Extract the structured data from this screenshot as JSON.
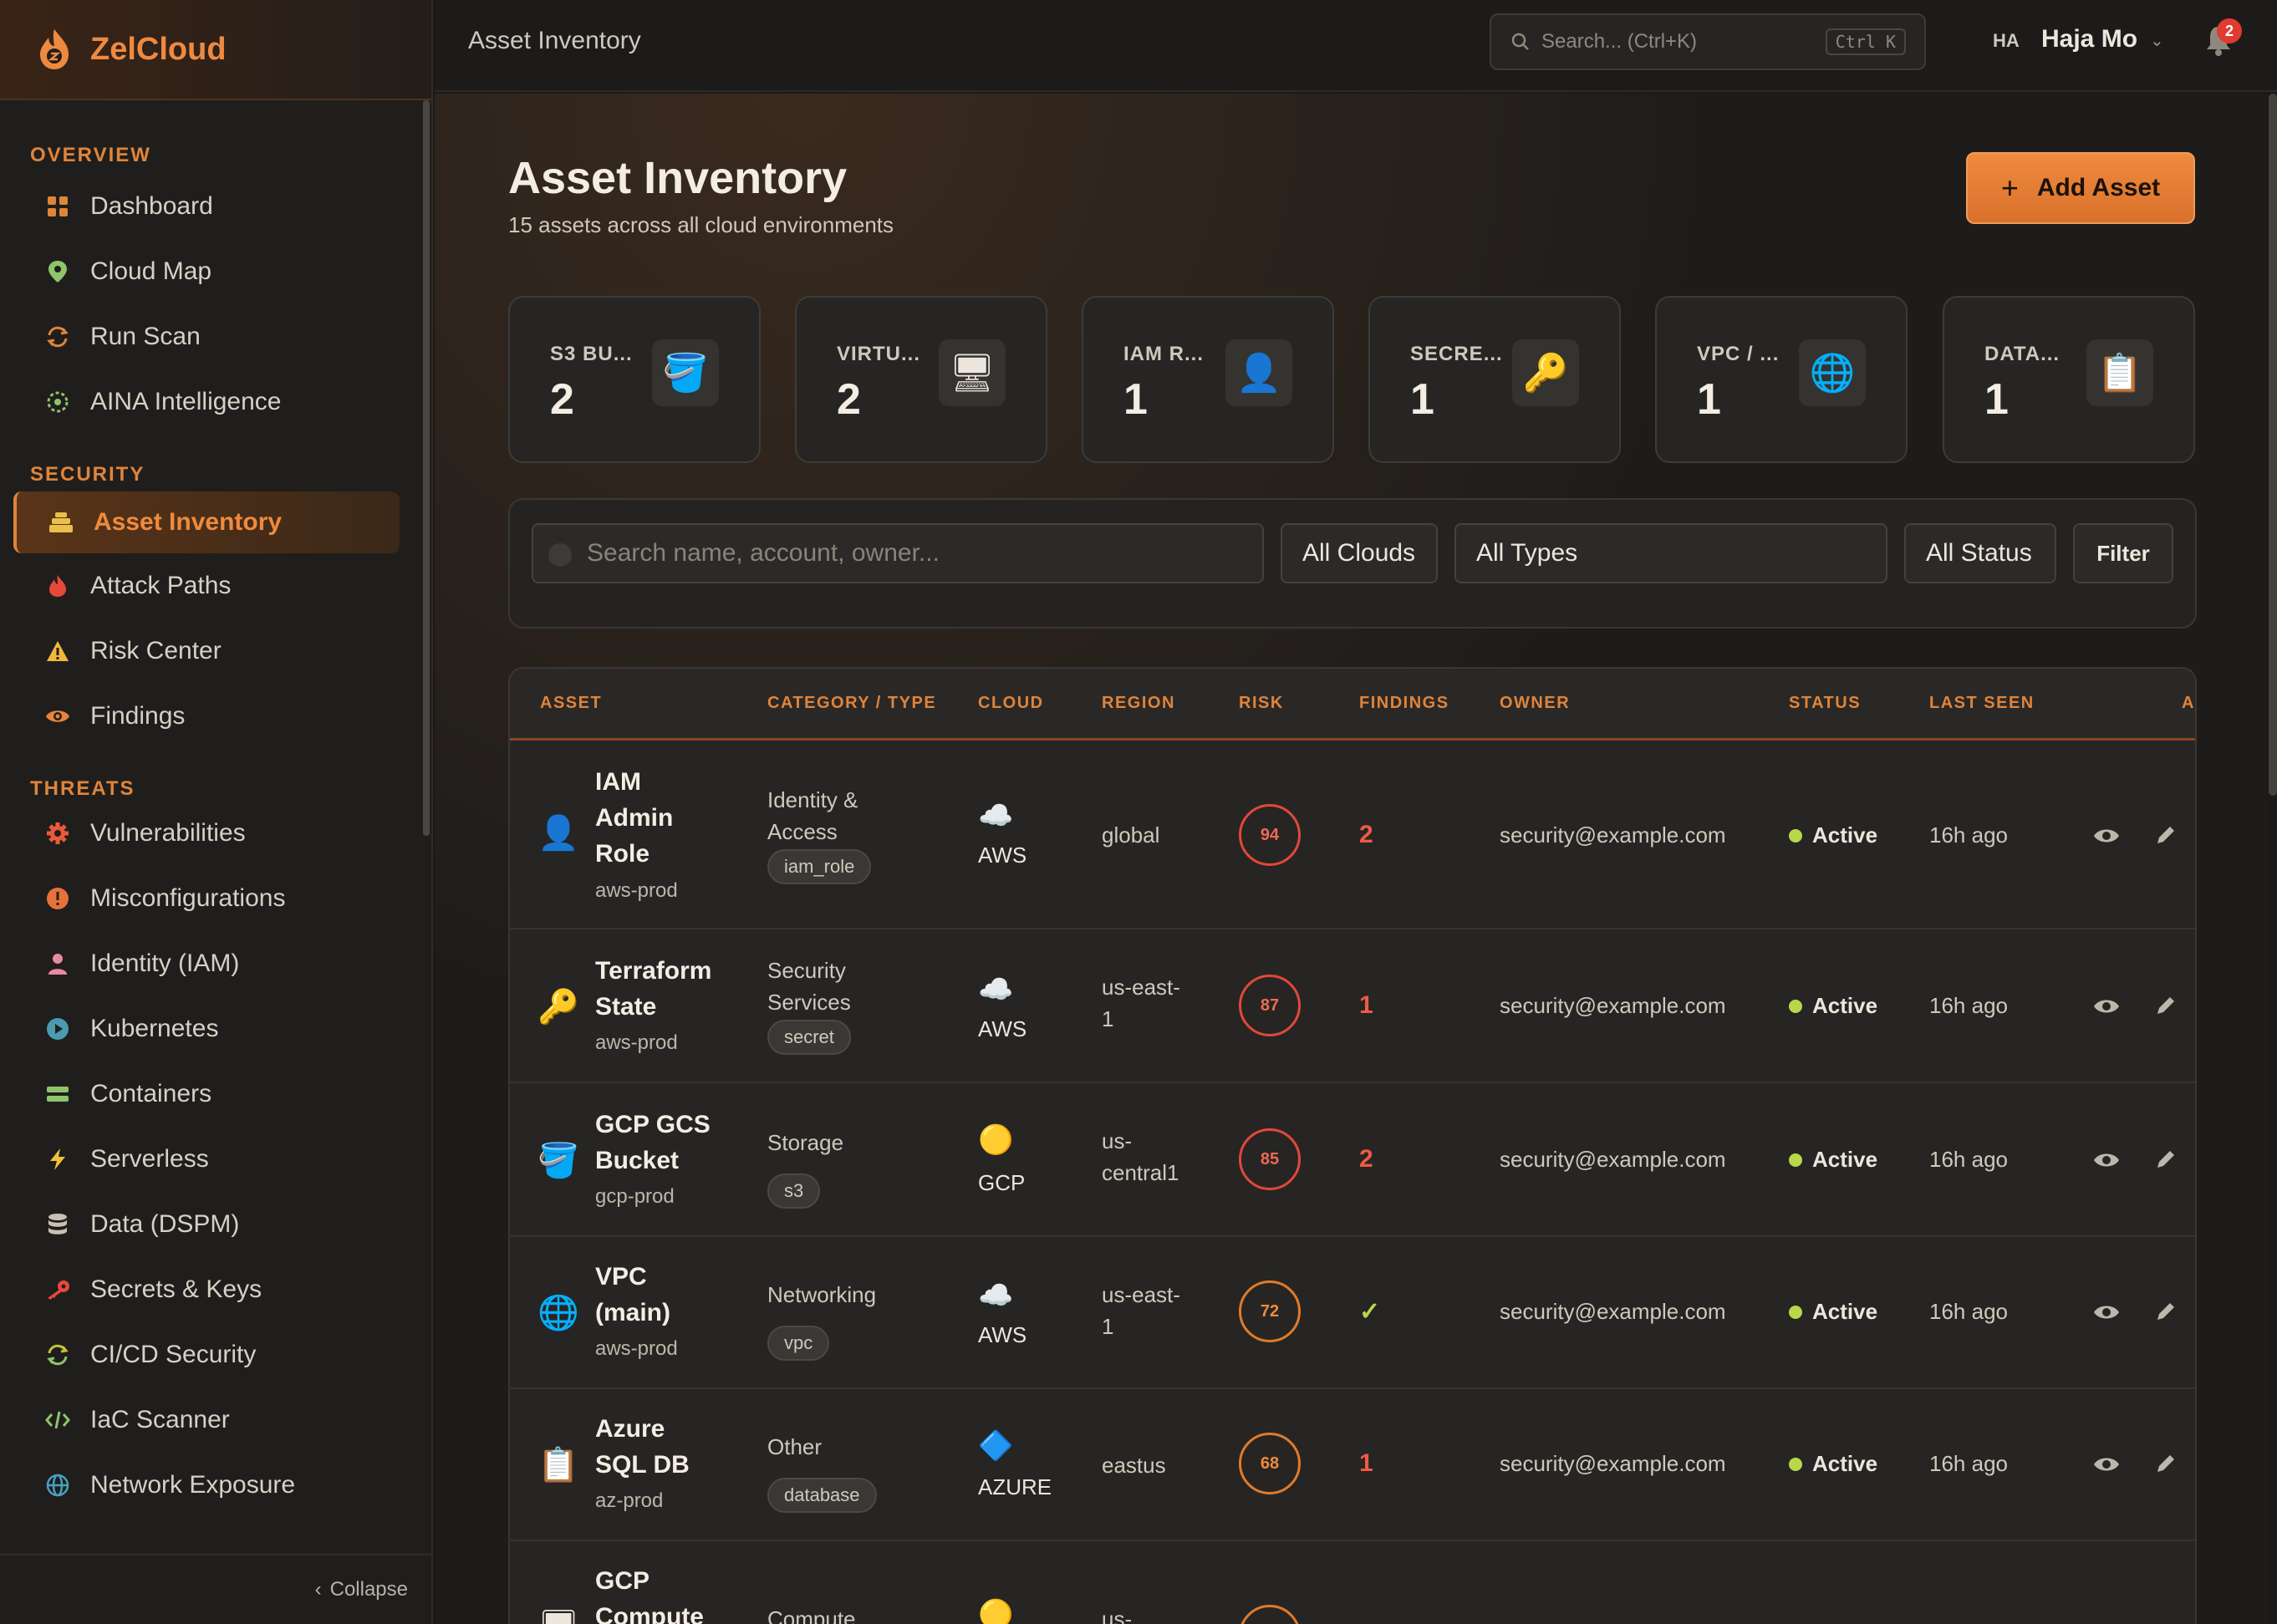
{
  "app": {
    "name": "ZelCloud"
  },
  "sidebar": {
    "sections": [
      {
        "label": "OVERVIEW",
        "items": [
          {
            "label": "Dashboard",
            "icon": "grid-icon"
          },
          {
            "label": "Cloud Map",
            "icon": "map-pin-icon"
          },
          {
            "label": "Run Scan",
            "icon": "refresh-icon"
          },
          {
            "label": "AINA Intelligence",
            "icon": "ai-icon"
          }
        ]
      },
      {
        "label": "SECURITY",
        "items": [
          {
            "label": "Asset Inventory",
            "icon": "layers-icon",
            "active": true
          },
          {
            "label": "Attack Paths",
            "icon": "flame-icon"
          },
          {
            "label": "Risk Center",
            "icon": "warning-icon"
          },
          {
            "label": "Findings",
            "icon": "eye-icon"
          }
        ]
      },
      {
        "label": "THREATS",
        "items": [
          {
            "label": "Vulnerabilities",
            "icon": "gear-icon"
          },
          {
            "label": "Misconfigurations",
            "icon": "alert-circle-icon"
          },
          {
            "label": "Identity (IAM)",
            "icon": "user-icon"
          },
          {
            "label": "Kubernetes",
            "icon": "play-circle-icon"
          },
          {
            "label": "Containers",
            "icon": "container-icon"
          },
          {
            "label": "Serverless",
            "icon": "bolt-icon"
          },
          {
            "label": "Data (DSPM)",
            "icon": "database-icon"
          },
          {
            "label": "Secrets & Keys",
            "icon": "key-icon"
          },
          {
            "label": "CI/CD Security",
            "icon": "sync-icon"
          },
          {
            "label": "IaC Scanner",
            "icon": "code-icon"
          },
          {
            "label": "Network Exposure",
            "icon": "globe-icon"
          }
        ]
      }
    ],
    "collapse_label": "Collapse"
  },
  "topbar": {
    "title": "Asset Inventory",
    "search_placeholder": "Search... (Ctrl+K)",
    "search_kbd": "Ctrl K",
    "user_initials": "HA",
    "user_name": "Haja Mo",
    "notifications": "2"
  },
  "page": {
    "title": "Asset Inventory",
    "subtitle": "15 assets across all cloud environments",
    "add_button": "Add Asset"
  },
  "stats": [
    {
      "label": "S3 BU...",
      "value": "2",
      "icon": "bucket-icon",
      "glyph": "🪣"
    },
    {
      "label": "VIRTU...",
      "value": "2",
      "icon": "monitor-icon",
      "glyph": "🖥"
    },
    {
      "label": "IAM R...",
      "value": "1",
      "icon": "user-icon",
      "glyph": "👤"
    },
    {
      "label": "SECRE...",
      "value": "1",
      "icon": "key-icon",
      "glyph": "🔑"
    },
    {
      "label": "VPC / ...",
      "value": "1",
      "icon": "globe-icon",
      "glyph": "🌐"
    },
    {
      "label": "DATA...",
      "value": "1",
      "icon": "clipboard-icon",
      "glyph": "📋"
    }
  ],
  "filters": {
    "search_placeholder": "Search name, account, owner...",
    "clouds": "All Clouds",
    "types": "All Types",
    "status": "All Status",
    "filter_button": "Filter"
  },
  "table": {
    "columns": [
      "ASSET",
      "CATEGORY / TYPE",
      "CLOUD",
      "REGION",
      "RISK",
      "FINDINGS",
      "OWNER",
      "STATUS",
      "LAST SEEN",
      "AC"
    ],
    "rows": [
      {
        "icon": "user-icon",
        "glyph": "👤",
        "name": "IAM Admin Role",
        "account": "aws-prod",
        "category": "Identity & Access",
        "type": "iam_role",
        "cloud_glyph": "☁️",
        "cloud": "AWS",
        "region": "global",
        "risk": "94",
        "findings": "2",
        "owner": "security@example.com",
        "status": "Active",
        "last_seen": "16h ago"
      },
      {
        "icon": "key-icon",
        "glyph": "🔑",
        "name": "Terraform State",
        "account": "aws-prod",
        "category": "Security Services",
        "type": "secret",
        "cloud_glyph": "☁️",
        "cloud": "AWS",
        "region": "us-east-1",
        "risk": "87",
        "findings": "1",
        "owner": "security@example.com",
        "status": "Active",
        "last_seen": "16h ago"
      },
      {
        "icon": "bucket-icon",
        "glyph": "🪣",
        "name": "GCP GCS Bucket",
        "account": "gcp-prod",
        "category": "Storage",
        "type": "s3",
        "cloud_glyph": "🟡",
        "cloud": "GCP",
        "region": "us-central1",
        "risk": "85",
        "findings": "2",
        "owner": "security@example.com",
        "status": "Active",
        "last_seen": "16h ago"
      },
      {
        "icon": "globe-icon",
        "glyph": "🌐",
        "name": "VPC (main)",
        "account": "aws-prod",
        "category": "Networking",
        "type": "vpc",
        "cloud_glyph": "☁️",
        "cloud": "AWS",
        "region": "us-east-1",
        "risk": "72",
        "findings": "✓",
        "owner": "security@example.com",
        "status": "Active",
        "last_seen": "16h ago"
      },
      {
        "icon": "clipboard-icon",
        "glyph": "📋",
        "name": "Azure SQL DB",
        "account": "az-prod",
        "category": "Other",
        "type": "database",
        "cloud_glyph": "🔷",
        "cloud": "AZURE",
        "region": "eastus",
        "risk": "68",
        "findings": "1",
        "owner": "security@example.com",
        "status": "Active",
        "last_seen": "16h ago"
      },
      {
        "icon": "monitor-icon",
        "glyph": "🖥",
        "name": "GCP Compute",
        "account": "",
        "category": "Compute",
        "type": "",
        "cloud_glyph": "🟡",
        "cloud": "",
        "region": "us-",
        "risk": "",
        "findings": "",
        "owner": "",
        "status": "",
        "last_seen": ""
      }
    ]
  },
  "colors": {
    "accent": "#e0843a",
    "danger": "#e0483a",
    "ok": "#b8d84a"
  }
}
